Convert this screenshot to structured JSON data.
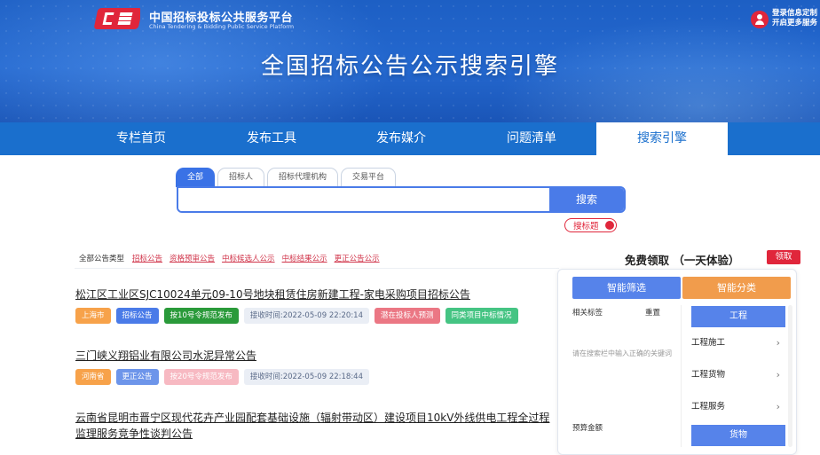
{
  "header": {
    "logo_cn": "中国招标投标公共服务平台",
    "logo_en": "China Tendering & Bidding Public Service Platform",
    "login_line1": "登录信息定制",
    "login_line2": "开启更多服务",
    "title": "全国招标公告公示搜索引擎"
  },
  "nav": {
    "items": [
      {
        "label": "专栏首页"
      },
      {
        "label": "发布工具"
      },
      {
        "label": "发布媒介"
      },
      {
        "label": "问题清单"
      },
      {
        "label": "搜索引擎"
      }
    ],
    "active_index": 4
  },
  "search": {
    "tabs": [
      {
        "label": "全部"
      },
      {
        "label": "招标人"
      },
      {
        "label": "招标代理机构"
      },
      {
        "label": "交易平台"
      }
    ],
    "input_value": "",
    "button_label": "搜索",
    "toggle_label": "搜标题",
    "toggle_on": true
  },
  "filter": {
    "label": "全部公告类型",
    "links": [
      "招标公告",
      "资格预审公告",
      "中标候选人公示",
      "中标结果公示",
      "更正公告公示"
    ]
  },
  "promo": {
    "text": "免费领取 （一天体验）",
    "button_label": "领取"
  },
  "results": [
    {
      "title": "松江区工业区SJC10024单元09-10号地块租赁住房新建工程-家电采购项目招标公告",
      "tags": [
        {
          "text": "上海市",
          "style": "orange"
        },
        {
          "text": "招标公告",
          "style": "blue"
        },
        {
          "text": "按10号令规范发布",
          "style": "green"
        },
        {
          "text": "接收时间:2022-05-09 22:20:14",
          "style": "gray"
        },
        {
          "text": "潜在投标人预测",
          "style": "pink"
        },
        {
          "text": "同类项目中标情况",
          "style": "lgreen"
        }
      ]
    },
    {
      "title": "三门峡义翔铝业有限公司水泥异常公告",
      "tags": [
        {
          "text": "河南省",
          "style": "orange"
        },
        {
          "text": "更正公告",
          "style": "lblue"
        },
        {
          "text": "按20号令规范发布",
          "style": "lpink"
        },
        {
          "text": "接收时间:2022-05-09 22:18:44",
          "style": "gray"
        }
      ]
    },
    {
      "title": "云南省昆明市晋宁区现代花卉产业园配套基础设施（辐射带动区）建设项目10kV外线供电工程全过程监理服务竞争性谈判公告",
      "tags": []
    }
  ],
  "side_panel": {
    "smart_filter_label": "智能筛选",
    "smart_class_label": "智能分类",
    "related_tags_label": "相关标签",
    "reset_label": "重置",
    "hint_text": "请在搜索栏中输入正确的关键词",
    "budget_label": "预算金额",
    "category_head": "工程",
    "categories": [
      "工程施工",
      "工程货物",
      "工程服务"
    ],
    "category_head2": "货物"
  }
}
